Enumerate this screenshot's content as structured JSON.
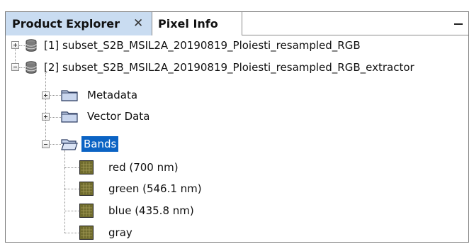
{
  "tabs": {
    "product_explorer": "Product Explorer",
    "close_glyph": "✕",
    "pixel_info": "Pixel Info"
  },
  "tree": {
    "products": [
      {
        "label": "[1] subset_S2B_MSIL2A_20190819_Ploiesti_resampled_RGB",
        "expanded": false
      },
      {
        "label": "[2] subset_S2B_MSIL2A_20190819_Ploiesti_resampled_RGB_extractor",
        "expanded": true
      }
    ],
    "groups": [
      {
        "label": "Metadata",
        "expanded": false
      },
      {
        "label": "Vector Data",
        "expanded": false
      },
      {
        "label": "Bands",
        "expanded": true,
        "selected": true
      }
    ],
    "bands": [
      {
        "label": "red (700 nm)"
      },
      {
        "label": "green (546.1 nm)"
      },
      {
        "label": "blue (435.8 nm)"
      },
      {
        "label": "gray"
      }
    ]
  },
  "colors": {
    "active_tab": "#c9dcf1",
    "selection": "#0b63c4",
    "folder": "#c9d6ee",
    "band_icon": "#6f6b2e"
  }
}
